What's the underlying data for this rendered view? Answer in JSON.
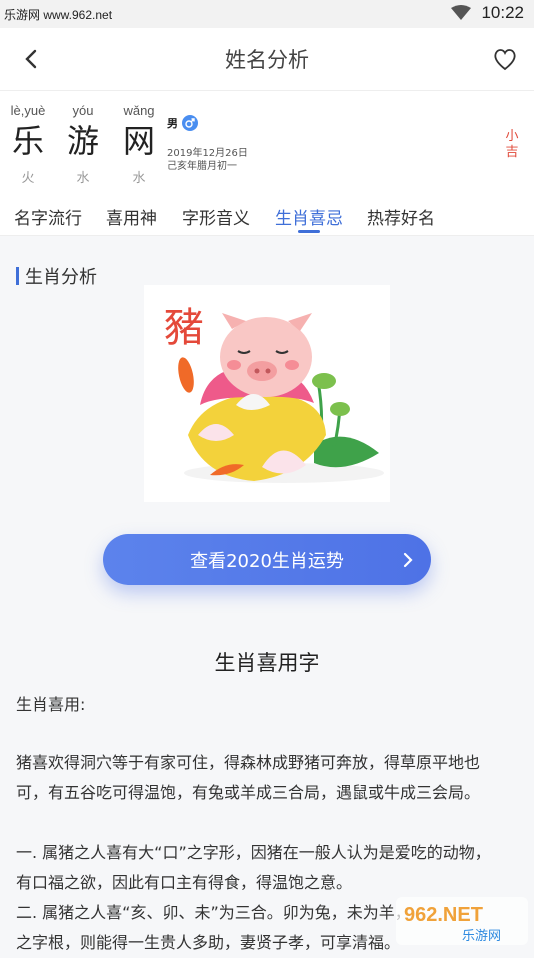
{
  "status_bar": {
    "carrier_text": "乐游网 www.962.net",
    "time": "10:22"
  },
  "app_bar": {
    "title": "姓名分析"
  },
  "name_card": {
    "chars": [
      {
        "pinyin": "lè,yuè",
        "hanzi": "乐",
        "element": "火"
      },
      {
        "pinyin": "yóu",
        "hanzi": "游",
        "element": "水"
      },
      {
        "pinyin": "wǎng",
        "hanzi": "网",
        "element": "水"
      }
    ],
    "gender": "男",
    "birth_date": "2019年12月26日",
    "lunar_date": "己亥年腊月初一",
    "luck": "小吉"
  },
  "tabs": [
    "名字流行",
    "喜用神",
    "字形音义",
    "生肖喜忌",
    "热荐好名"
  ],
  "active_tab": "生肖喜忌",
  "section": {
    "title": "生肖分析",
    "image_text": "豬"
  },
  "cta": {
    "label": "查看2020生肖运势"
  },
  "content": {
    "heading": "生肖喜用字",
    "intro": "生肖喜用:",
    "para1_line1": "猪喜欢得洞穴等于有家可住，得森林成野猪可奔放，得草原平地也",
    "para1_line2": "可，有五谷吃可得温饱，有兔或羊成三合局，遇鼠或牛成三会局。",
    "item1_line1": "一. 属猪之人喜有大“口”之字形，因猪在一般人认为是爱吃的动物，",
    "item1_line2": "有口福之欲，因此有口主有得食，得温饱之意。",
    "item2_line1": "二. 属猪之人喜“亥、卯、未”为三合。卯为兔，未为羊，",
    "item2_line2": "之字根，则能得一生贵人多助，妻贤子孝，可享清福。"
  },
  "watermark": {
    "logo": "962.NET",
    "sub": "乐游网"
  },
  "colors": {
    "accent": "#3f6fd8",
    "luck": "#e04a3a"
  }
}
